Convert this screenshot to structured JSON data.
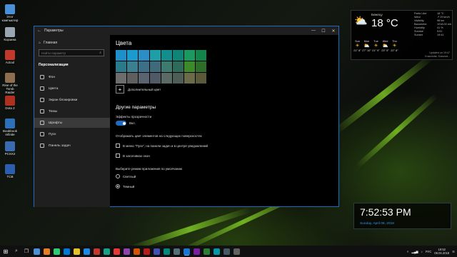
{
  "desktop_icons": [
    {
      "label": "Этот компьютер",
      "color": "#4a90d9"
    },
    {
      "label": "Корзина",
      "color": "#9aa6b2"
    },
    {
      "label": "Actool",
      "color": "#c0392b"
    },
    {
      "label": "Rise of the Tomb Raider",
      "color": "#8e6e4e"
    },
    {
      "label": "Dota 2",
      "color": "#b03020"
    },
    {
      "label": "Bookbook Infinite",
      "color": "#2d6fb8"
    },
    {
      "label": "PCSX2",
      "color": "#3a6ab0"
    },
    {
      "label": "TCB",
      "color": "#2b5fae"
    }
  ],
  "window": {
    "title": "Параметры",
    "back_glyph": "←",
    "minimize_glyph": "—",
    "maximize_glyph": "☐",
    "close_glyph": "✕"
  },
  "sidebar": {
    "home_label": "Главная",
    "search_placeholder": "Найти параметр",
    "section_title": "Персонализация",
    "items": [
      {
        "label": "Фон"
      },
      {
        "label": "Цвета"
      },
      {
        "label": "Экран блокировки"
      },
      {
        "label": "Темы"
      },
      {
        "label": "Шрифты"
      },
      {
        "label": "Пуск"
      },
      {
        "label": "Панель задач"
      }
    ],
    "selected_index": 4
  },
  "main": {
    "heading": "Цвета",
    "swatches": [
      "#1e8fc9",
      "#1a9acd",
      "#2b8ec4",
      "#1e9fa8",
      "#148e8c",
      "#0f8578",
      "#1a9a60",
      "#14854a",
      "#2b7a8a",
      "#3b7f90",
      "#3d6f86",
      "#3e6a7a",
      "#3e7a70",
      "#2f6b5b",
      "#3d8a2a",
      "#2c6e2a",
      "#6d6d6d",
      "#5f5f5f",
      "#5a6470",
      "#4f5a66",
      "#5c6a66",
      "#4f5d57",
      "#6b6a49",
      "#5a5a3a"
    ],
    "custom_color_label": "Дополнительный цвет",
    "other_params_title": "Другие параметры",
    "transparency_label": "Эффекты прозрачности",
    "transparency_state": "Вкл.",
    "show_accent_label": "Отображать цвет элементов на следующих поверхностях",
    "checkbox_start": "В меню \"Пуск\", на панели задач и в центре уведомлений",
    "checkbox_titlebars": "В заголовках окон",
    "app_mode_label": "Выберите режим приложения по умолчанию",
    "mode_light": "Светлый",
    "mode_dark": "Темный",
    "mode_selected": "dark"
  },
  "weather": {
    "city": "Бежецу",
    "temp": "18 °C",
    "stats": [
      {
        "k": "Feels Like",
        "v": "18 °C"
      },
      {
        "k": "Wind",
        "v": "↗ 29 km/h"
      },
      {
        "k": "Visibility",
        "v": "98 km"
      },
      {
        "k": "Barometer",
        "v": "1018.00 mb"
      },
      {
        "k": "Humidity",
        "v": "41 %"
      },
      {
        "k": "",
        "v": ""
      },
      {
        "k": "Sunrise",
        "v": "5:51"
      },
      {
        "k": "Sunset",
        "v": "19:41"
      }
    ],
    "days": [
      {
        "name": "Sun",
        "icon": "☀",
        "temps": "21° 8°"
      },
      {
        "name": "Mon",
        "icon": "⛅",
        "temps": "27° 10°"
      },
      {
        "name": "Tue",
        "icon": "☀",
        "temps": "21° 9°"
      },
      {
        "name": "Wed",
        "icon": "⛅",
        "temps": "23° 5°"
      },
      {
        "name": "Thu",
        "icon": "☀",
        "temps": "22° 8°"
      }
    ],
    "updated": "Updated on 19:47",
    "location": "Krasnodar, Krasnod..."
  },
  "clock": {
    "time": "7:52:53 PM",
    "date": "Sunday, April 08, 2018"
  },
  "taskbar": {
    "start_glyph": "⊞",
    "apps": [
      "#4a90d9",
      "#e67e22",
      "#2ecc71",
      "#0078d7",
      "#e6c229",
      "#1e88e5",
      "#c0392b",
      "#16a085",
      "#e53935",
      "#8e44ad",
      "#d35400",
      "#b71c1c",
      "#3f51b5",
      "#00897b",
      "#546e7a",
      "#1976d2",
      "#7b1fa2",
      "#2e7d32",
      "#0097a7",
      "#455a64",
      "#616161"
    ],
    "tray_lang": "РУС",
    "tray_time": "19:52",
    "tray_date": "08.04.2018"
  }
}
